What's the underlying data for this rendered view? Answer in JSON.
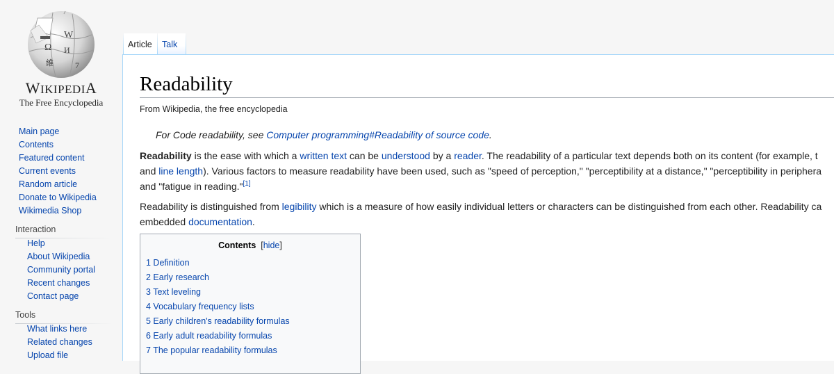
{
  "logo": {
    "wordmark_big": "W",
    "wordmark_rest": "IKIPEDI",
    "wordmark_end": "A",
    "tagline": "The Free Encyclopedia"
  },
  "sidebar": {
    "navigation": [
      "Main page",
      "Contents",
      "Featured content",
      "Current events",
      "Random article",
      "Donate to Wikipedia",
      "Wikimedia Shop"
    ],
    "interaction_heading": "Interaction",
    "interaction": [
      "Help",
      "About Wikipedia",
      "Community portal",
      "Recent changes",
      "Contact page"
    ],
    "tools_heading": "Tools",
    "tools": [
      "What links here",
      "Related changes",
      "Upload file"
    ]
  },
  "tabs": {
    "article": "Article",
    "talk": "Talk"
  },
  "article": {
    "title": "Readability",
    "site_sub": "From Wikipedia, the free encyclopedia",
    "hatnote_prefix": "For Code readability, see ",
    "hatnote_link": "Computer programming#Readability of source code",
    "hatnote_suffix": ".",
    "p1_line1": {
      "t1": "Readability",
      "t2": " is the ease with which a ",
      "l1": "written text",
      "t3": " can be ",
      "l2": "understood",
      "t4": " by a ",
      "l3": "reader",
      "t5": ". The readability of a particular text depends both on its content (for example, t"
    },
    "p1_line2": {
      "t1": "and ",
      "l1": "line length",
      "t2": "). Various factors to measure readability have been used, such as \"speed of perception,\" \"perceptibility at a distance,\" \"perceptibility in periphera"
    },
    "p1_line3": {
      "t1": "and \"fatigue in reading.\"",
      "ref": "[1]"
    },
    "p2_line1": {
      "t1": "Readability is distinguished from ",
      "l1": "legibility",
      "t2": " which is a measure of how easily individual letters or characters can be distinguished from each other. Readability ca"
    },
    "p2_line2": {
      "t1": "embedded ",
      "l1": "documentation",
      "t2": "."
    }
  },
  "toc": {
    "title": "Contents",
    "hide": "hide",
    "items": [
      "1 Definition",
      "2 Early research",
      "3 Text leveling",
      "4 Vocabulary frequency lists",
      "5 Early children's readability formulas",
      "6 Early adult readability formulas",
      "7 The popular readability formulas"
    ]
  }
}
